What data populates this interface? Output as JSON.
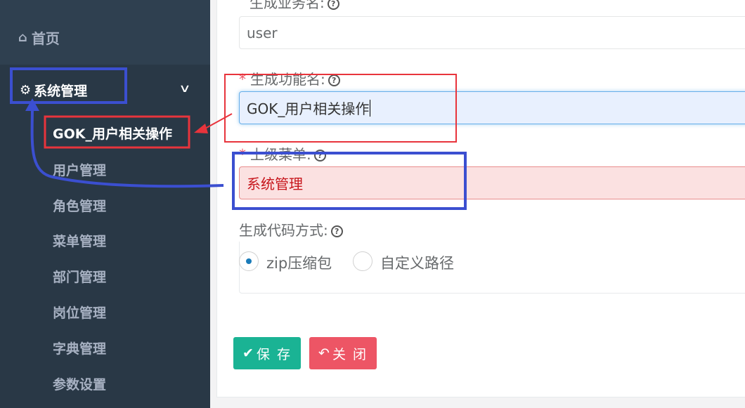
{
  "sidebar": {
    "home": "首页",
    "group": "系统管理",
    "items": [
      "GOK_用户相关操作",
      "用户管理",
      "角色管理",
      "菜单管理",
      "部门管理",
      "岗位管理",
      "字典管理",
      "参数设置"
    ]
  },
  "form": {
    "business_name_label": "生成业务名:",
    "business_name_value": "user",
    "function_name_label": "生成功能名:",
    "function_name_value": "GOK_用户相关操作",
    "parent_menu_label": "上级菜单:",
    "parent_menu_value": "系统管理",
    "gen_mode_label": "生成代码方式:",
    "options": [
      "zip压缩包",
      "自定义路径"
    ],
    "selected_option": "zip压缩包"
  },
  "buttons": {
    "save": "保 存",
    "close": "关 闭"
  },
  "colors": {
    "sidebar": "#2f4050",
    "save": "#1ab394",
    "close": "#ed5565",
    "annotation_red": "#e8343c",
    "annotation_blue": "#3b4fd0"
  },
  "icons": [
    "home-icon",
    "gear-icon",
    "chevron-down-icon",
    "check-icon",
    "reply-icon",
    "question-circle-icon"
  ]
}
